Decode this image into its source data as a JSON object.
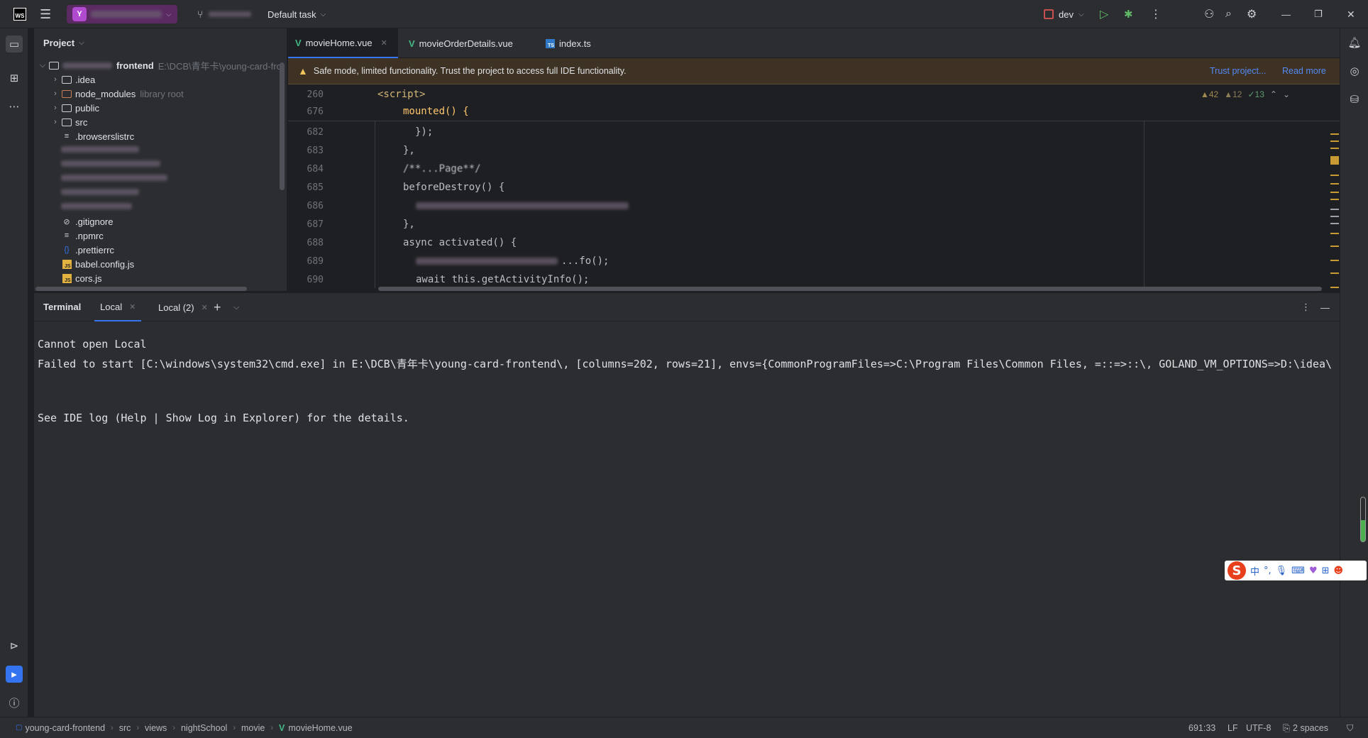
{
  "titlebar": {
    "app_logo": "WS",
    "project_initial": "Y",
    "task": "Default task",
    "run_config": "dev",
    "icons": [
      "menu-icon",
      "branch-icon",
      "run-icon",
      "debug-icon",
      "more-icon",
      "add-user-icon",
      "search-icon",
      "settings-icon",
      "minimize-icon",
      "restore-icon",
      "close-icon"
    ]
  },
  "project_panel": {
    "title": "Project",
    "root_path": "E:\\DCB\\青年卡\\young-card-fro",
    "root_name": "frontend",
    "items": [
      {
        "name": ".idea",
        "kind": "folder",
        "expandable": true
      },
      {
        "name": "node_modules",
        "kind": "folder-lib",
        "expandable": true,
        "hint": "library root"
      },
      {
        "name": "public",
        "kind": "folder",
        "expandable": true
      },
      {
        "name": "src",
        "kind": "folder",
        "expandable": true
      },
      {
        "name": ".browserslistrc",
        "kind": "text"
      },
      {
        "name": ".gitignore",
        "kind": "ignore"
      },
      {
        "name": ".npmrc",
        "kind": "text"
      },
      {
        "name": ".prettierrc",
        "kind": "json"
      },
      {
        "name": "babel.config.js",
        "kind": "js"
      },
      {
        "name": "cors.js",
        "kind": "js"
      }
    ]
  },
  "editor": {
    "tabs": [
      {
        "label": "movieHome.vue",
        "type": "vue",
        "active": true
      },
      {
        "label": "movieOrderDetails.vue",
        "type": "vue",
        "active": false
      },
      {
        "label": "index.ts",
        "type": "ts",
        "active": false
      }
    ],
    "banner": {
      "text": "Safe mode, limited functionality. Trust the project to access full IDE functionality.",
      "trust_link": "Trust project...",
      "read_more": "Read more"
    },
    "inspections": {
      "warnings": "42",
      "weak_warnings": "12",
      "ok": "13"
    },
    "sticky_lines": [
      {
        "ln": "260",
        "code": "<script>"
      },
      {
        "ln": "676",
        "code": "mounted() {"
      }
    ],
    "lines": [
      {
        "ln": "682",
        "code": "});"
      },
      {
        "ln": "683",
        "code": "},"
      },
      {
        "ln": "684",
        "code": "/**...Page**/"
      },
      {
        "ln": "685",
        "code": "beforeDestroy() {"
      },
      {
        "ln": "686",
        "code": ""
      },
      {
        "ln": "687",
        "code": "},"
      },
      {
        "ln": "688",
        "code": "async activated() {"
      },
      {
        "ln": "689",
        "code": "...fo();"
      },
      {
        "ln": "690",
        "code": "await this.getActivityInfo();"
      }
    ]
  },
  "terminal": {
    "title": "Terminal",
    "tabs": [
      "Local",
      "Local (2)"
    ],
    "lines": [
      "Cannot open Local",
      "Failed to start [C:\\windows\\system32\\cmd.exe] in E:\\DCB\\青年卡\\young-card-frontend\\, [columns=202, rows=21], envs={CommonProgramFiles=>C:\\Program Files\\Common Files, =::=>::\\, GOLAND_VM_OPTIONS=>D:\\idea\\",
      "",
      "",
      "See IDE log (Help | Show Log in Explorer) for the details."
    ]
  },
  "ime": {
    "mode": "中",
    "punct": "°,"
  },
  "statusbar": {
    "breadcrumbs": [
      "young-card-frontend",
      "src",
      "views",
      "nightSchool",
      "movie",
      "movieHome.vue"
    ],
    "position": "691:33",
    "line_sep": "LF",
    "encoding": "UTF-8",
    "indent": "2 spaces"
  },
  "colors": {
    "accent": "#3574f0",
    "vue": "#42b883",
    "warning_banner": "#3d3223",
    "link": "#548af7"
  }
}
